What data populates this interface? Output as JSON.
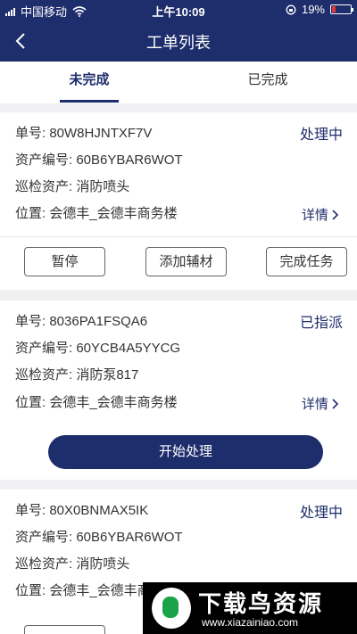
{
  "status_bar": {
    "carrier": "中国移动",
    "time": "上午10:09",
    "battery": "19%"
  },
  "header": {
    "title": "工单列表"
  },
  "tabs": [
    {
      "label": "未完成"
    },
    {
      "label": "已完成"
    }
  ],
  "orders": [
    {
      "number_label": "单号:",
      "number": "80W8HJNTXF7V",
      "status": "处理中",
      "asset_code_label": "资产编号:",
      "asset_code": "60B6YBAR6WOT",
      "asset_label": "巡检资产:",
      "asset": "消防喷头",
      "location_label": "位置:",
      "location": "会德丰_会德丰商务楼",
      "detail": "详情",
      "buttons": {
        "pause": "暂停",
        "add_material": "添加辅材",
        "complete": "完成任务"
      }
    },
    {
      "number_label": "单号:",
      "number": "8036PA1FSQA6",
      "status": "已指派",
      "asset_code_label": "资产编号:",
      "asset_code": "60YCB4A5YYCG",
      "asset_label": "巡检资产:",
      "asset": "消防泵817",
      "location_label": "位置:",
      "location": "会德丰_会德丰商务楼",
      "detail": "详情",
      "buttons": {
        "start": "开始处理"
      }
    },
    {
      "number_label": "单号:",
      "number": "80X0BNMAX5IK",
      "status": "处理中",
      "asset_code_label": "资产编号:",
      "asset_code": "60B6YBAR6WOT",
      "asset_label": "巡检资产:",
      "asset": "消防喷头",
      "location_label": "位置:",
      "location": "会德丰_会德丰商务楼"
    }
  ],
  "watermark": {
    "title": "下载鸟资源",
    "url": "www.xiazainiao.com"
  },
  "colors": {
    "primary": "#1e2d6b",
    "background": "#f0f0f2"
  }
}
